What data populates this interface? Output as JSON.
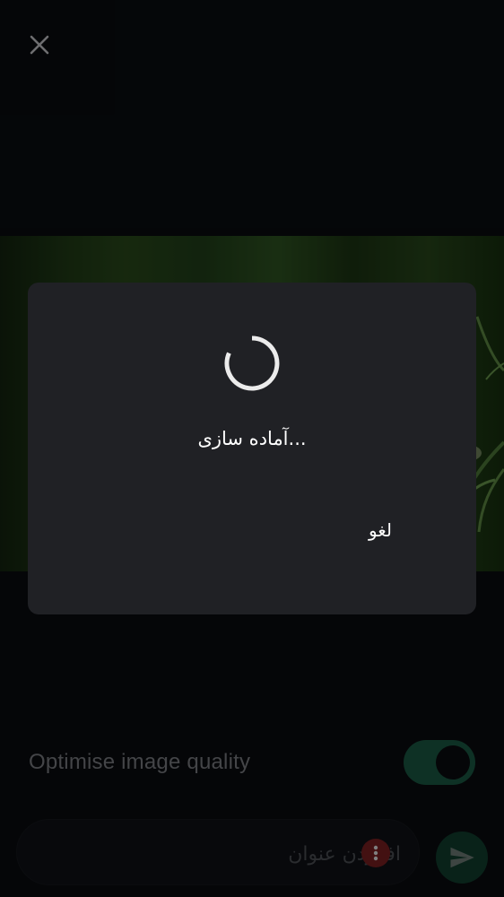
{
  "header": {
    "close_icon": "close-icon"
  },
  "settings": {
    "optimise_label": "Optimise image quality",
    "optimise_enabled": true
  },
  "composer": {
    "caption_placeholder": "افزودن عنوان",
    "caption_value": "",
    "more_icon": "more-vertical-icon",
    "send_icon": "send-icon"
  },
  "dialog": {
    "message": "...آماده سازی",
    "cancel_label": "لغو",
    "spinner_icon": "loading-spinner-icon"
  },
  "colors": {
    "background": "#0a0c10",
    "dialog": "#202125",
    "accent": "#1b5a44",
    "badge": "#7a1f21"
  }
}
